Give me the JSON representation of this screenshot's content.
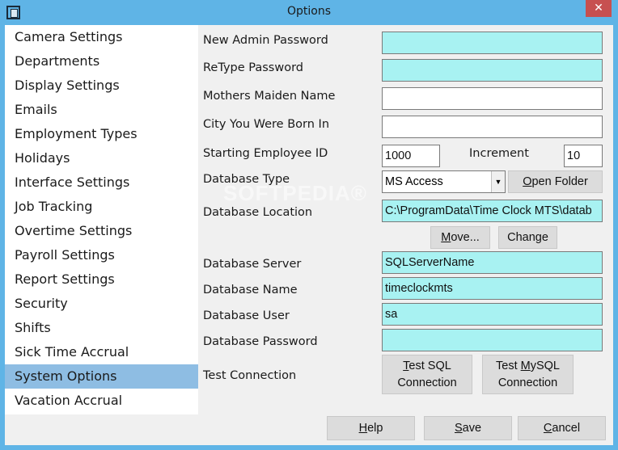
{
  "window": {
    "title": "Options",
    "close_glyph": "✕",
    "watermark": "SOFTPEDIA®",
    "icons": [
      "app-icon",
      "close-icon",
      "chevron-down-icon"
    ]
  },
  "sidebar": {
    "items": [
      {
        "label": "Camera Settings"
      },
      {
        "label": "Departments"
      },
      {
        "label": "Display Settings"
      },
      {
        "label": "Emails"
      },
      {
        "label": "Employment Types"
      },
      {
        "label": "Holidays"
      },
      {
        "label": "Interface Settings"
      },
      {
        "label": "Job Tracking"
      },
      {
        "label": "Overtime Settings"
      },
      {
        "label": "Payroll Settings"
      },
      {
        "label": "Report Settings"
      },
      {
        "label": "Security"
      },
      {
        "label": "Shifts"
      },
      {
        "label": "Sick Time Accrual"
      },
      {
        "label": "System Options"
      },
      {
        "label": "Vacation Accrual"
      }
    ],
    "selected": "System Options",
    "selected_color": "#8ebde3"
  },
  "form": {
    "new_admin_password": {
      "label": "New Admin Password",
      "value": ""
    },
    "retype_password": {
      "label": "ReType Password",
      "value": ""
    },
    "mothers_maiden_name": {
      "label": "Mothers Maiden Name",
      "value": ""
    },
    "city_born": {
      "label": "City You Were Born In",
      "value": ""
    },
    "starting_employee_id": {
      "label": "Starting Employee ID",
      "value": "1000"
    },
    "increment": {
      "label": "Increment",
      "value": "10"
    },
    "database_type": {
      "label": "Database Type",
      "value": "MS Access"
    },
    "open_folder": {
      "prefix": "",
      "accel": "O",
      "rest": "pen Folder"
    },
    "database_location": {
      "label": "Database Location",
      "value": "C:\\ProgramData\\Time Clock MTS\\datab"
    },
    "move": {
      "prefix": "",
      "accel": "M",
      "rest": "ove..."
    },
    "change": {
      "label": "Change"
    },
    "database_server": {
      "label": "Database Server",
      "value": "SQLServerName"
    },
    "database_name": {
      "label": "Database Name",
      "value": "timeclockmts"
    },
    "database_user": {
      "label": "Database User",
      "value": "sa"
    },
    "database_password": {
      "label": "Database Password",
      "value": ""
    },
    "test_connection": {
      "label": "Test Connection"
    },
    "test_sql": {
      "accel": "T",
      "line1_rest": "est SQL",
      "line2": "Connection"
    },
    "test_mysql": {
      "line1_prefix": "Test ",
      "accel": "M",
      "line1_rest": "ySQL",
      "line2": "Connection"
    },
    "input_highlight_color": "#a8f2f2"
  },
  "footer": {
    "help": {
      "prefix": "",
      "accel": "H",
      "rest": "elp"
    },
    "save": {
      "prefix": "",
      "accel": "S",
      "rest": "ave"
    },
    "cancel": {
      "prefix": "",
      "accel": "C",
      "rest": "ancel"
    }
  }
}
